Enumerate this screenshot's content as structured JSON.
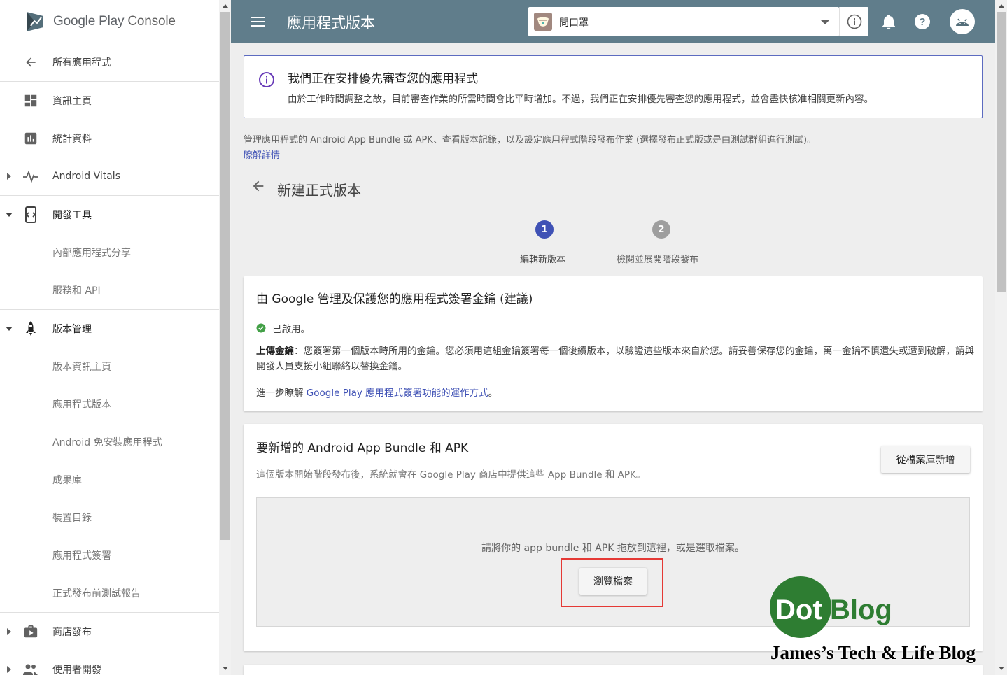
{
  "brand": {
    "google_play": "Google Play",
    "console": "Console"
  },
  "sidebar": {
    "back_item": {
      "label": "所有應用程式",
      "icon": "arrow-back-icon"
    },
    "items": [
      {
        "label": "資訊主頁",
        "icon": "dashboard-icon"
      },
      {
        "label": "統計資料",
        "icon": "bar-chart-icon"
      },
      {
        "label": "Android Vitals",
        "icon": "vitals-pulse-icon",
        "expandable": true
      },
      {
        "label": "開發工具",
        "icon": "dev-tools-icon",
        "expanded": true
      },
      {
        "label": "內部應用程式分享"
      },
      {
        "label": "服務和 API"
      },
      {
        "label": "版本管理",
        "icon": "rocket-icon",
        "expanded": true
      },
      {
        "label": "版本資訊主頁"
      },
      {
        "label": "應用程式版本",
        "active": true
      },
      {
        "label": "Android 免安裝應用程式"
      },
      {
        "label": "成果庫"
      },
      {
        "label": "裝置目錄"
      },
      {
        "label": "應用程式簽署"
      },
      {
        "label": "正式發布前測試報告"
      },
      {
        "label": "商店發布",
        "icon": "store-icon",
        "expandable": true
      },
      {
        "label": "使用者開發",
        "icon": "users-icon",
        "expandable": true
      }
    ]
  },
  "header": {
    "title": "應用程式版本",
    "app_name": "問口罩",
    "background_color": "#607d8b"
  },
  "notice": {
    "title": "我們正在安排優先審查您的應用程式",
    "body": "由於工作時間調整之故，目前審查作業的所需時間會比平時增加。不過，我們正在安排優先審查您的應用程式，並會盡快核准相關更新內容。"
  },
  "main": {
    "description": "管理應用程式的 Android App Bundle 或 APK、查看版本記錄，以及設定應用程式階段發布作業 (選擇發布正式版或是由測試群組進行測試)。",
    "learn_more": "瞭解詳情",
    "page_title": "新建正式版本"
  },
  "stepper": {
    "steps": [
      {
        "number": "1",
        "label": "編輯新版本",
        "active": true
      },
      {
        "number": "2",
        "label": "檢閱並展開階段發布",
        "active": false
      }
    ]
  },
  "signing_card": {
    "title": "由 Google 管理及保護您的應用程式簽署金鑰 (建議)",
    "status": "已啟用。",
    "upload_key_label": "上傳金鑰",
    "upload_key_text": "：您簽署第一個版本時所用的金鑰。您必須用這組金鑰簽署每一個後續版本，以驗證這些版本來自於您。請妥善保存您的金鑰，萬一金鑰不慎遺失或遭到破解，請與開發人員支援小組聯絡以替換金鑰。",
    "more_prefix": "進一步瞭解 ",
    "more_link": "Google Play 應用程式簽署功能的運作方式",
    "more_suffix": "。"
  },
  "bundle_card": {
    "title": "要新增的 Android App Bundle 和 APK",
    "subtitle": "這個版本開始階段發布後，系統就會在 Google Play 商店中提供這些 App Bundle 和 APK。",
    "library_button": "從檔案庫新增",
    "dropzone_text": "請將你的 app bundle 和 APK 拖放到這裡，或是選取檔案。",
    "browse_button": "瀏覽檔案"
  },
  "watermark": {
    "dot": "Dot",
    "blog": "Blog",
    "tagline": "James’s Tech & Life Blog"
  },
  "colors": {
    "accent": "#3f51b5",
    "step_active": "#3f51b5",
    "step_inactive": "#9e9e9e",
    "highlight": "#e53935",
    "watermark_green": "#2e7d32"
  }
}
